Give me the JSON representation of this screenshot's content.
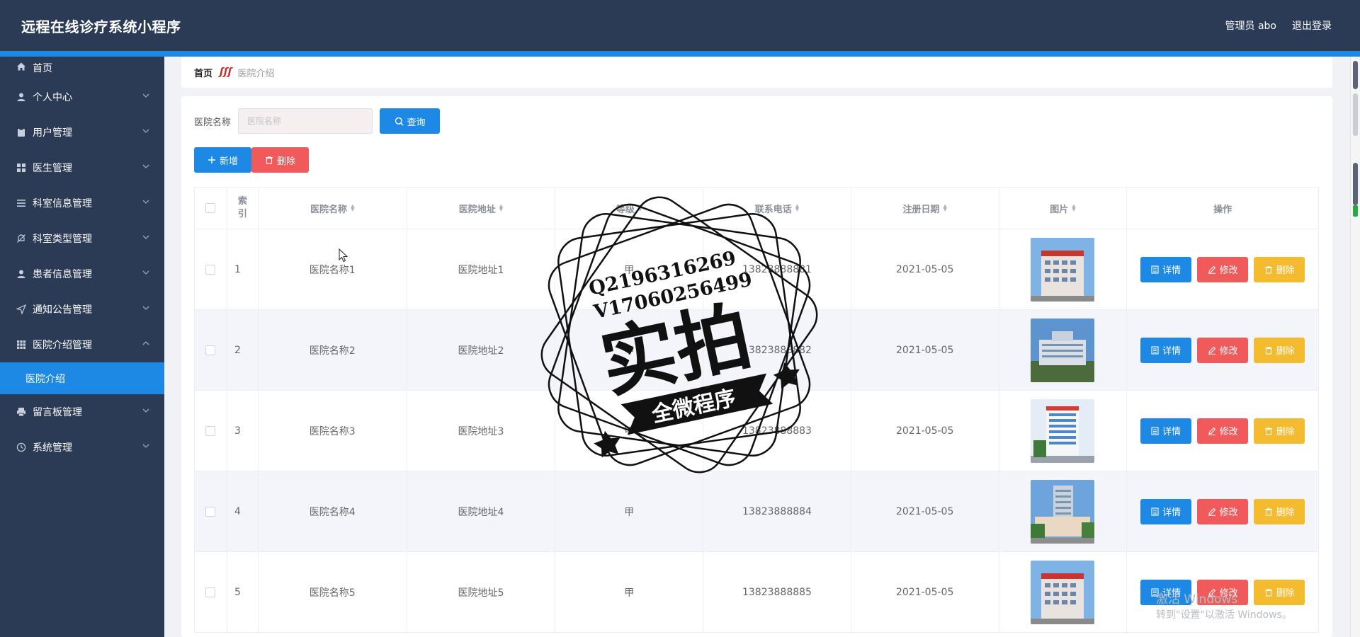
{
  "app": {
    "title": "远程在线诊疗系统小程序",
    "user_label": "管理员 abo",
    "logout_label": "退出登录"
  },
  "sidebar": {
    "items": [
      {
        "label": "首页",
        "icon": "home-icon"
      },
      {
        "label": "个人中心",
        "icon": "user-icon"
      },
      {
        "label": "用户管理",
        "icon": "clipboard-icon"
      },
      {
        "label": "医生管理",
        "icon": "grid-icon"
      },
      {
        "label": "科室信息管理",
        "icon": "list-icon"
      },
      {
        "label": "科室类型管理",
        "icon": "bell-off-icon"
      },
      {
        "label": "患者信息管理",
        "icon": "user-icon"
      },
      {
        "label": "通知公告管理",
        "icon": "send-icon"
      },
      {
        "label": "医院介绍管理",
        "icon": "grid-icon"
      },
      {
        "label": "医院介绍",
        "icon": ""
      },
      {
        "label": "留言板管理",
        "icon": "printer-icon"
      },
      {
        "label": "系统管理",
        "icon": "clock-icon"
      }
    ]
  },
  "breadcrumb": {
    "home": "首页",
    "separator": "ʃʃʃ",
    "current": "医院介绍"
  },
  "search": {
    "label": "医院名称",
    "placeholder": "医院名称",
    "query_button": "查询"
  },
  "actions": {
    "add_button": "新增",
    "delete_button": "删除"
  },
  "table": {
    "headers": {
      "index_top": "索",
      "index_bottom": "引",
      "name": "医院名称",
      "address": "医院地址",
      "level": "等级",
      "phone": "联系电话",
      "date": "注册日期",
      "image": "图片",
      "ops": "操作"
    },
    "rows": [
      {
        "index": "1",
        "name": "医院名称1",
        "address": "医院地址1",
        "level": "甲",
        "phone": "13823888881",
        "date": "2021-05-05"
      },
      {
        "index": "2",
        "name": "医院名称2",
        "address": "医院地址2",
        "level": "甲",
        "phone": "13823888882",
        "date": "2021-05-05"
      },
      {
        "index": "3",
        "name": "医院名称3",
        "address": "医院地址3",
        "level": "甲",
        "phone": "13823888883",
        "date": "2021-05-05"
      },
      {
        "index": "4",
        "name": "医院名称4",
        "address": "医院地址4",
        "level": "甲",
        "phone": "13823888884",
        "date": "2021-05-05"
      },
      {
        "index": "5",
        "name": "医院名称5",
        "address": "医院地址5",
        "level": "甲",
        "phone": "13823888885",
        "date": "2021-05-05"
      }
    ],
    "row_buttons": {
      "detail": "详情",
      "edit": "修改",
      "delete": "删除"
    }
  },
  "stamp": {
    "line1": "Q2196316269",
    "line2": "V17060256499",
    "big": "实拍",
    "banner": "全微程序"
  },
  "windows_watermark": {
    "line1": "激活 Windows",
    "line2": "转到\"设置\"以激活 Windows。"
  },
  "colors": {
    "header_bg": "#2b3a55",
    "accent": "#1e88e5",
    "danger": "#f05a5a",
    "warning": "#f5bb2e"
  }
}
